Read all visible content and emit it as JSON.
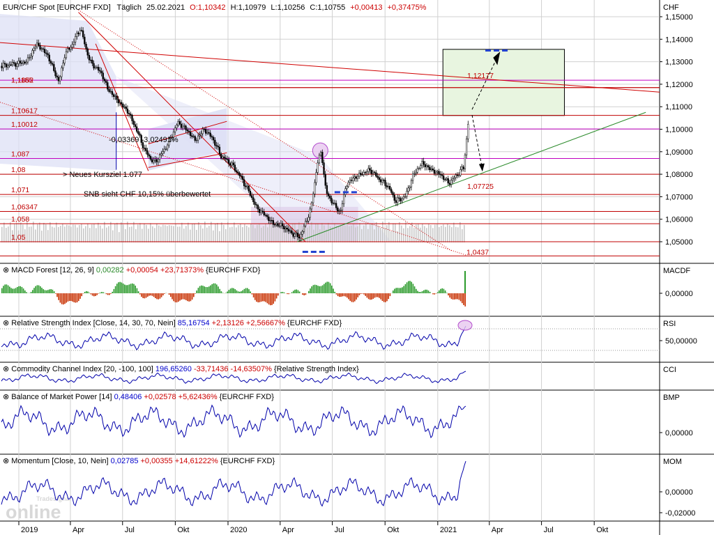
{
  "chart_data": [
    {
      "type": "candlestick",
      "title": "EUR/CHF Spot [EURCHF FXD] Täglich",
      "header": {
        "symbol": "EUR/CHF Spot [EURCHF FXD]",
        "period": "Täglich",
        "date": "25.02.2021",
        "open": "O:1,10342",
        "high": "H:1,10979",
        "low": "L:1,10256",
        "close": "C:1,10755",
        "change": "+0,00413",
        "change_pct": "+0,37475%"
      },
      "ylabel": "CHF",
      "ylim": [
        1.04,
        1.155
      ],
      "y_ticks": [
        "1,15000",
        "1,14000",
        "1,13000",
        "1,12000",
        "1,11000",
        "1,10000",
        "1,09000",
        "1,08000",
        "1,07000",
        "1,06000",
        "1,05000"
      ],
      "y_tick_values": [
        1.15,
        1.14,
        1.13,
        1.12,
        1.11,
        1.1,
        1.09,
        1.08,
        1.07,
        1.06,
        1.05
      ],
      "x_labels": [
        "2019",
        "Apr",
        "Jul",
        "Okt",
        "2020",
        "Apr",
        "Jul",
        "Okt",
        "2021",
        "Apr",
        "Jul",
        "Okt"
      ],
      "x_label_dates": [
        "2019-01-01",
        "2019-04-01",
        "2019-07-01",
        "2019-10-01",
        "2020-01-01",
        "2020-04-01",
        "2020-07-01",
        "2020-10-01",
        "2021-01-01",
        "2021-04-01",
        "2021-07-01",
        "2021-10-01"
      ],
      "price_path": [
        [
          "2018-12-01",
          1.128
        ],
        [
          "2019-01-15",
          1.13
        ],
        [
          "2019-02-01",
          1.138
        ],
        [
          "2019-02-20",
          1.133
        ],
        [
          "2019-03-05",
          1.125
        ],
        [
          "2019-03-12",
          1.121
        ],
        [
          "2019-03-22",
          1.133
        ],
        [
          "2019-04-05",
          1.138
        ],
        [
          "2019-04-18",
          1.145
        ],
        [
          "2019-05-05",
          1.13
        ],
        [
          "2019-05-25",
          1.125
        ],
        [
          "2019-06-05",
          1.118
        ],
        [
          "2019-06-25",
          1.112
        ],
        [
          "2019-07-10",
          1.108
        ],
        [
          "2019-07-25",
          1.1
        ],
        [
          "2019-08-10",
          1.09
        ],
        [
          "2019-08-25",
          1.085
        ],
        [
          "2019-09-10",
          1.09
        ],
        [
          "2019-09-25",
          1.097
        ],
        [
          "2019-10-05",
          1.103
        ],
        [
          "2019-10-20",
          1.1
        ],
        [
          "2019-11-05",
          1.095
        ],
        [
          "2019-11-20",
          1.1
        ],
        [
          "2019-12-05",
          1.096
        ],
        [
          "2019-12-20",
          1.088
        ],
        [
          "2020-01-05",
          1.085
        ],
        [
          "2020-01-20",
          1.08
        ],
        [
          "2020-02-05",
          1.073
        ],
        [
          "2020-02-20",
          1.065
        ],
        [
          "2020-03-05",
          1.062
        ],
        [
          "2020-03-20",
          1.058
        ],
        [
          "2020-04-05",
          1.057
        ],
        [
          "2020-04-20",
          1.054
        ],
        [
          "2020-05-05",
          1.052
        ],
        [
          "2020-05-15",
          1.058
        ],
        [
          "2020-05-25",
          1.065
        ],
        [
          "2020-06-05",
          1.085
        ],
        [
          "2020-06-12",
          1.09
        ],
        [
          "2020-06-20",
          1.072
        ],
        [
          "2020-07-05",
          1.066
        ],
        [
          "2020-07-15",
          1.063
        ],
        [
          "2020-07-25",
          1.075
        ],
        [
          "2020-08-05",
          1.078
        ],
        [
          "2020-08-20",
          1.08
        ],
        [
          "2020-09-05",
          1.082
        ],
        [
          "2020-09-20",
          1.078
        ],
        [
          "2020-10-05",
          1.075
        ],
        [
          "2020-10-20",
          1.068
        ],
        [
          "2020-11-05",
          1.07
        ],
        [
          "2020-11-20",
          1.08
        ],
        [
          "2020-12-05",
          1.085
        ],
        [
          "2020-12-20",
          1.082
        ],
        [
          "2021-01-05",
          1.08
        ],
        [
          "2021-01-20",
          1.076
        ],
        [
          "2021-02-05",
          1.08
        ],
        [
          "2021-02-15",
          1.083
        ],
        [
          "2021-02-20",
          1.095
        ],
        [
          "2021-02-25",
          1.10755
        ]
      ],
      "levels": [
        {
          "value": 1.12177,
          "label": "1,12177",
          "color": "#c000c0"
        },
        {
          "value": 1.1185,
          "label": "1,1185",
          "color": "#c00000"
        },
        {
          "value": 1.1185,
          "label": "1,1852",
          "color": "#c00000"
        },
        {
          "value": 1.10617,
          "label": "1,10617",
          "color": "#c00000"
        },
        {
          "value": 1.10012,
          "label": "1,10012",
          "color": "#c000c0"
        },
        {
          "value": 1.087,
          "label": "1,087",
          "color": "#c000c0"
        },
        {
          "value": 1.08,
          "label": "1,08",
          "color": "#c00000"
        },
        {
          "value": 1.071,
          "label": "1,071",
          "color": "#c00000"
        },
        {
          "value": 1.06347,
          "label": "1,06347",
          "color": "#c00000"
        },
        {
          "value": 1.058,
          "label": "1,058",
          "color": "#c00000"
        },
        {
          "value": 1.05,
          "label": "1,05",
          "color": "#c00000"
        },
        {
          "value": 1.0437,
          "label": "1,0437",
          "color": "#c00000"
        },
        {
          "value": 1.07725,
          "label": "1,07725",
          "color": "#2a8a2a"
        }
      ],
      "annotations": [
        {
          "text": "-0,03369 -3,02491%",
          "color": "#0000cc"
        },
        {
          "text": "> Neues Kursziel 1.077",
          "color": "#0000cc"
        },
        {
          "text": "SNB sieht CHF 10,15% überbewertet",
          "color": "#2a8a2a"
        }
      ],
      "target_box": {
        "date_from": "2021-01-10",
        "date_to": "2021-08-10",
        "y_from": 1.1061,
        "y_to": 1.1355,
        "color": "#e8f5e0"
      }
    },
    {
      "type": "bar",
      "title": "MACD Forest [12, 26, 9]",
      "legend_parts": [
        {
          "text": "MACD Forest [12, 26, 9] ",
          "color": "#000000"
        },
        {
          "text": "0,00282",
          "color": "#2a8a2a"
        },
        {
          "text": " +0,00054 +23,71373%",
          "color": "#cc0000"
        },
        {
          "text": " {EURCHF FXD}",
          "color": "#000000"
        }
      ],
      "ylabel": "MACDF",
      "y_ticks": [
        "0,00000"
      ],
      "last_value": 0.00282
    },
    {
      "type": "line",
      "title": "Relative Strength Index [Close, 14, 30, 70, Nein]",
      "legend_parts": [
        {
          "text": "Relative Strength Index [Close, 14, 30, 70, Nein] ",
          "color": "#000000"
        },
        {
          "text": "85,16754",
          "color": "#0000cc"
        },
        {
          "text": " +2,13126 +2,56667%",
          "color": "#cc0000"
        },
        {
          "text": " {EURCHF FXD}",
          "color": "#000000"
        }
      ],
      "ylabel": "RSI",
      "y_ticks": [
        "50,00000"
      ],
      "last_value": 85.16754
    },
    {
      "type": "line",
      "title": "Commodity Channel Index [20, -100, 100]",
      "legend_parts": [
        {
          "text": "Commodity Channel Index [20, -100, 100] ",
          "color": "#000000"
        },
        {
          "text": "196,65260",
          "color": "#0000cc"
        },
        {
          "text": " -33,71436 -14,63507%",
          "color": "#cc0000"
        },
        {
          "text": " {Relative Strength Index}",
          "color": "#000000"
        }
      ],
      "ylabel": "CCI",
      "last_value": 196.6526
    },
    {
      "type": "line",
      "title": "Balance of Market Power [14]",
      "legend_parts": [
        {
          "text": "Balance of Market Power [14] ",
          "color": "#000000"
        },
        {
          "text": "0,48406",
          "color": "#0000cc"
        },
        {
          "text": " +0,02578 +5,62436%",
          "color": "#cc0000"
        },
        {
          "text": " {EURCHF FXD}",
          "color": "#000000"
        }
      ],
      "ylabel": "BMP",
      "y_ticks": [
        "0,00000"
      ],
      "last_value": 0.48406
    },
    {
      "type": "line",
      "title": "Momentum [Close, 10, Nein]",
      "legend_parts": [
        {
          "text": "Momentum [Close, 10, Nein] ",
          "color": "#000000"
        },
        {
          "text": "0,02785",
          "color": "#0000cc"
        },
        {
          "text": " +0,00355 +14,61222%",
          "color": "#cc0000"
        },
        {
          "text": " {EURCHF FXD}",
          "color": "#000000"
        }
      ],
      "ylabel": "MOM",
      "y_ticks": [
        "0,00000",
        "-0,02000"
      ],
      "last_value": 0.02785
    }
  ],
  "watermark": {
    "brand": "online",
    "sub": "Tradesignal"
  },
  "colors": {
    "grid": "#d0d0d0",
    "candle_up": "#ffffff",
    "candle_down": "#000000",
    "volume": "#c8c8c8",
    "channel_fill": "#dde0f5",
    "red_line": "#d00000",
    "magenta_line": "#c000c0",
    "green_line": "#2a8a2a",
    "blue_line": "#0000aa",
    "forest_pos": "#2a9a2a",
    "forest_neg": "#c83000"
  }
}
